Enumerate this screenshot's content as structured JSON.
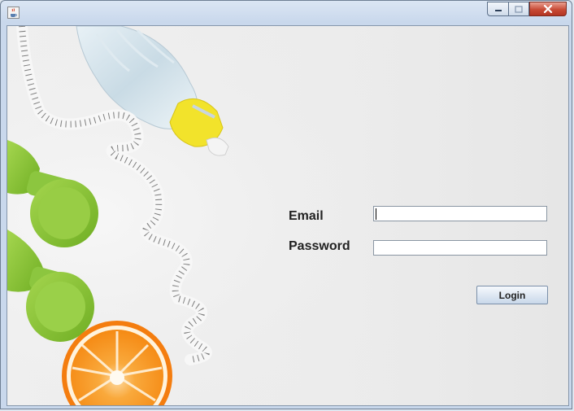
{
  "window": {
    "controls": [
      "minimize-icon",
      "maximize-icon",
      "close-icon"
    ],
    "app_icon": "java-cup-icon"
  },
  "form": {
    "email_label": "Email",
    "email_value": "",
    "password_label": "Password",
    "password_value": "",
    "login_label": "Login"
  },
  "background_image": {
    "objects": [
      "water-bottle",
      "measuring-tape",
      "green-dumbbells",
      "orange-slice"
    ]
  },
  "colors": {
    "accent_green": "#8cc63f",
    "orange": "#f7931e",
    "bottle_cap": "#f2e32b",
    "close_button": "#c84a35"
  }
}
